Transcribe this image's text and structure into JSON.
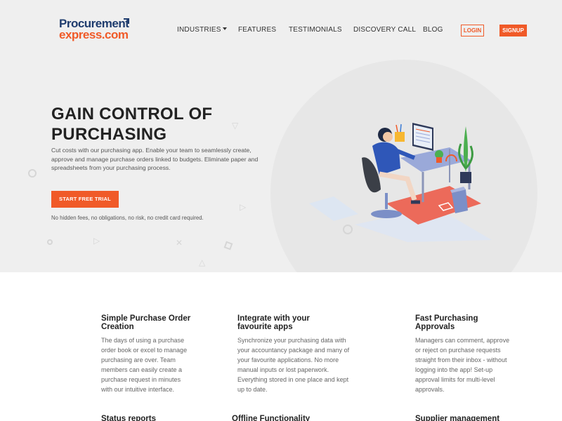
{
  "brand": {
    "line1": "Procurement",
    "line2": "express.com"
  },
  "nav": {
    "items": [
      {
        "label": "INDUSTRIES",
        "dropdown": true
      },
      {
        "label": "FEATURES"
      },
      {
        "label": "TESTIMONIALS"
      },
      {
        "label": "DISCOVERY CALL"
      },
      {
        "label": "BLOG"
      }
    ],
    "login": "LOGIN",
    "signup": "SIGNUP"
  },
  "hero": {
    "title": "GAIN CONTROL OF PURCHASING",
    "description": "Cut costs with our purchasing app. Enable your team to seamlessly create, approve and manage purchase orders linked to budgets. Eliminate paper and spreadsheets from your purchasing process.",
    "cta": "START FREE TRIAL",
    "note": "No hidden fees, no obligations, no risk, no credit card required."
  },
  "features": [
    {
      "title": "Simple Purchase Order Creation",
      "description": "The days of using a purchase order book or excel to manage purchasing are over. Team members can easily create a purchase request in minutes with our intuitive interface."
    },
    {
      "title": "Integrate with your favourite apps",
      "description": "Synchronize your purchasing data with your accountancy package and many of your favourite applications. No more manual inputs or lost paperwork. Everything stored in one place and kept up to date."
    },
    {
      "title": "Fast Purchasing Approvals",
      "description": "Managers can comment, approve or reject on purchase requests straight from their inbox - without logging into the app! Set-up approval limits for multi-level approvals."
    },
    {
      "title": "Status reports"
    },
    {
      "title": "Offline Functionality"
    },
    {
      "title": "Supplier management"
    }
  ],
  "colors": {
    "accent": "#f05a28",
    "brand_navy": "#1f3c6e",
    "hero_bg": "#efefef"
  }
}
